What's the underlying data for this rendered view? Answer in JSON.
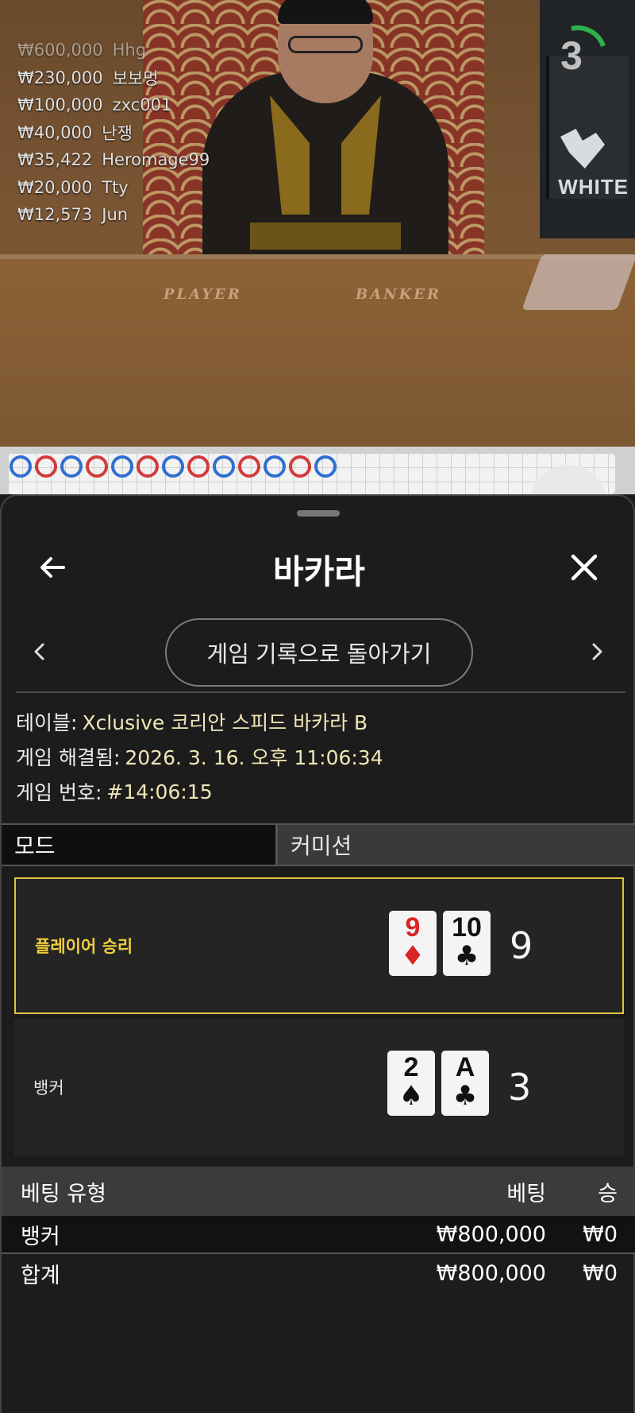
{
  "video": {
    "winners": [
      {
        "amount": "₩600,000",
        "name": "Hhg"
      },
      {
        "amount": "₩230,000",
        "name": "보보멍"
      },
      {
        "amount": "₩100,000",
        "name": "zxc001"
      },
      {
        "amount": "₩40,000",
        "name": "난쟁"
      },
      {
        "amount": "₩35,422",
        "name": "Heromage99"
      },
      {
        "amount": "₩20,000",
        "name": "Tty"
      },
      {
        "amount": "₩12,573",
        "name": "Jun"
      }
    ],
    "countdown": "3",
    "table_words": {
      "player": "PLAYER",
      "banker": "BANKER"
    },
    "logo_text": "WHITE"
  },
  "road": {
    "beads": [
      "player",
      "banker",
      "player",
      "banker",
      "player",
      "banker",
      "player",
      "banker",
      "player",
      "banker",
      "player",
      "banker",
      "player"
    ]
  },
  "sheet": {
    "title": "바카라",
    "history_button": "게임 기록으로 돌아가기",
    "info": {
      "table_label": "테이블:",
      "table_value": "Xclusive 코리안 스피드 바카라 B",
      "resolved_label": "게임 해결됨:",
      "resolved_value": "2026. 3. 16. 오후 11:06:34",
      "round_label": "게임 번호:",
      "round_value": "#14:06:15"
    },
    "tabs": {
      "mode": "모드",
      "commission": "커미션"
    },
    "results": {
      "player": {
        "label": "플레이어 승리",
        "cards": [
          {
            "rank": "9",
            "suit": "♦"
          },
          {
            "rank": "10",
            "suit": "♣"
          }
        ],
        "score": "9"
      },
      "banker": {
        "label": "뱅커",
        "cards": [
          {
            "rank": "2",
            "suit": "♠"
          },
          {
            "rank": "A",
            "suit": "♣"
          }
        ],
        "score": "3"
      }
    },
    "bets": {
      "headers": {
        "type": "베팅 유형",
        "bet": "베팅",
        "win": "승"
      },
      "rows": [
        {
          "type": "뱅커",
          "bet": "₩800,000",
          "win": "₩0"
        }
      ],
      "total": {
        "type": "합계",
        "bet": "₩800,000",
        "win": "₩0"
      }
    }
  },
  "colors": {
    "accent": "#f0cf3c",
    "player_blue": "#2f6fd1",
    "banker_red": "#d33a3a"
  }
}
